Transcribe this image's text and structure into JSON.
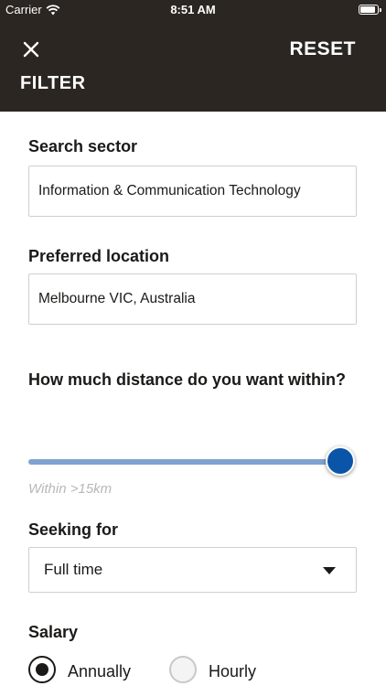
{
  "status_bar": {
    "carrier": "Carrier",
    "time": "8:51 AM"
  },
  "header": {
    "reset_label": "RESET",
    "title": "FILTER"
  },
  "sector": {
    "label": "Search sector",
    "value": "Information & Communication Technology"
  },
  "location": {
    "label": "Preferred location",
    "value": "Melbourne VIC, Australia"
  },
  "distance": {
    "question": "How much distance do you want within?",
    "caption": "Within >15km",
    "level": 1.0
  },
  "seeking": {
    "label": "Seeking for",
    "value": "Full time"
  },
  "salary": {
    "label": "Salary",
    "options": [
      {
        "label": "Annually",
        "selected": true
      },
      {
        "label": "Hourly",
        "selected": false
      }
    ]
  },
  "colors": {
    "header_bg": "#2b2622",
    "slider_track": "#7ea3cf",
    "slider_thumb": "#0b55a8"
  },
  "icons": {
    "close": "close-icon",
    "dropdown": "chevron-down-icon",
    "wifi": "wifi-icon",
    "battery": "battery-icon"
  }
}
